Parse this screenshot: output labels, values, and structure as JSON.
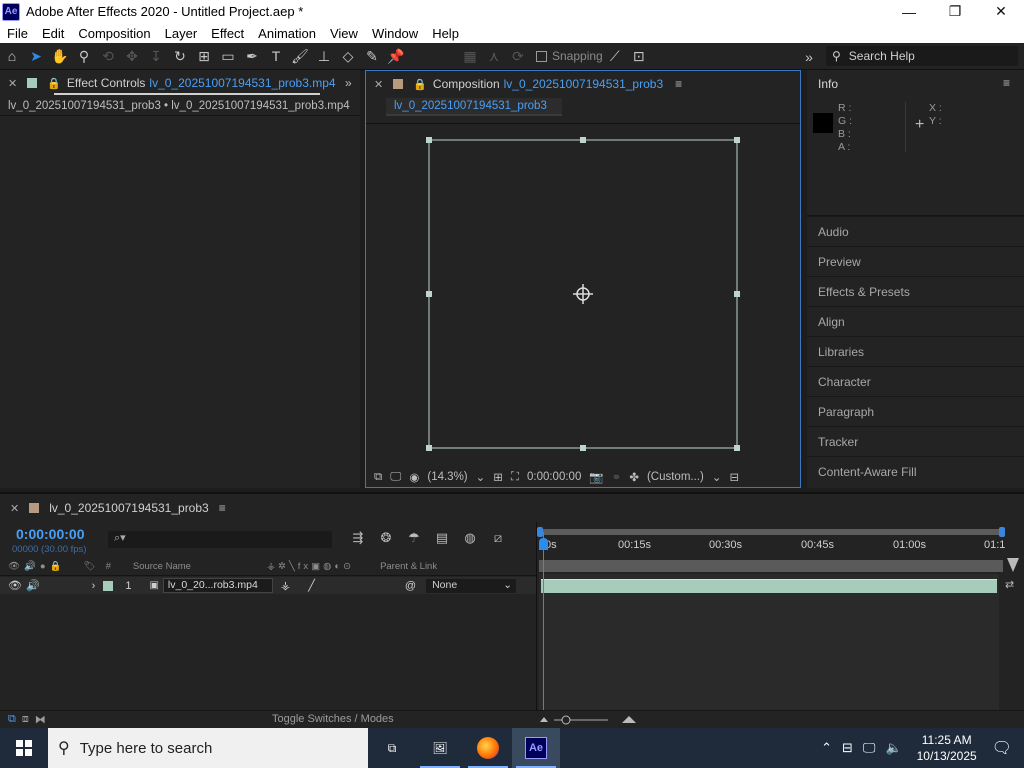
{
  "window": {
    "app_icon": "Ae",
    "title": "Adobe After Effects 2020 - Untitled Project.aep *",
    "controls": [
      "minimize-icon",
      "maximize-icon",
      "close-icon"
    ]
  },
  "menu": [
    "File",
    "Edit",
    "Composition",
    "Layer",
    "Effect",
    "Animation",
    "View",
    "Window",
    "Help"
  ],
  "toolbar": {
    "snapping_label": "Snapping",
    "search_placeholder": "Search Help"
  },
  "effect_controls": {
    "tab_label": "Effect Controls",
    "tab_file": "lv_0_20251007194531_prob3.mp4",
    "breadcrumb": "lv_0_20251007194531_prob3 • lv_0_20251007194531_prob3.mp4"
  },
  "composition": {
    "tab_label": "Composition",
    "tab_name": "lv_0_20251007194531_prob3",
    "chip": "lv_0_20251007194531_prob3",
    "zoom": "(14.3%)",
    "timecode": "0:00:00:00",
    "resolution": "(Custom...)"
  },
  "info": {
    "title": "Info",
    "r": "R :",
    "g": "G :",
    "b": "B :",
    "a": "A :",
    "x": "X :",
    "y": "Y :"
  },
  "right_panels": [
    "Audio",
    "Preview",
    "Effects & Presets",
    "Align",
    "Libraries",
    "Character",
    "Paragraph",
    "Tracker",
    "Content-Aware Fill"
  ],
  "timeline": {
    "tab_name": "lv_0_20251007194531_prob3",
    "timecode": "0:00:00:00",
    "fps": "00000 (30.00 fps)",
    "search_placeholder": "⌕▾",
    "columns": {
      "num": "#",
      "source": "Source Name",
      "parent": "Parent & Link"
    },
    "layer": {
      "index": "1",
      "name": "lv_0_20...rob3.mp4",
      "parent": "None"
    },
    "ruler": [
      "0s",
      "00:15s",
      "00:30s",
      "00:45s",
      "01:00s",
      "01:1"
    ],
    "status_label": "Toggle Switches / Modes"
  },
  "taskbar": {
    "search_placeholder": "Type here to search",
    "time": "11:25 AM",
    "date": "10/13/2025"
  }
}
